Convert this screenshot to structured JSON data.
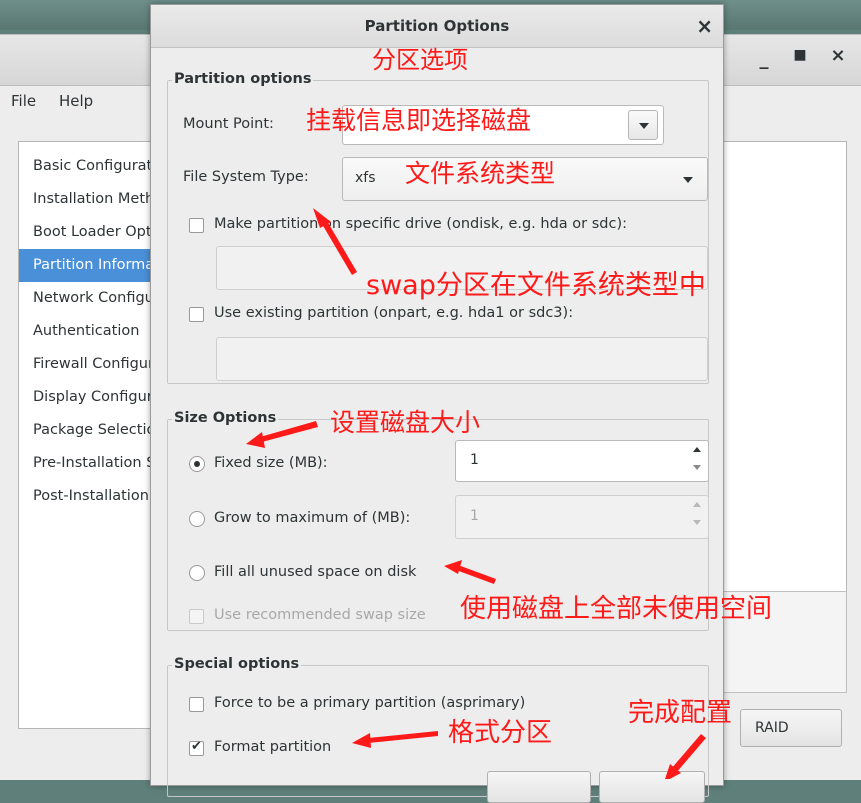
{
  "main_window": {
    "menu": [
      "File",
      "Help"
    ],
    "sidebar_items": [
      "Basic Configuration",
      "Installation Method",
      "Boot Loader Options",
      "Partition Information",
      "Network Configuration",
      "Authentication",
      "Firewall Configuration",
      "Display Configuration",
      "Package Selection",
      "Pre-Installation Script",
      "Post-Installation Script"
    ],
    "selected_index": 3,
    "raid_button": "RAID"
  },
  "dialog": {
    "title": "Partition Options",
    "close_glyph": "×",
    "partition_options": {
      "heading": "Partition options",
      "mount_point_label": "Mount Point:",
      "mount_point_value": "",
      "fs_type_label": "File System Type:",
      "fs_type_value": "xfs",
      "ondisk_label": "Make partition on specific drive (ondisk, e.g. hda or sdc):",
      "ondisk_checked": false,
      "ondisk_value": "",
      "onpart_label": "Use existing partition (onpart, e.g. hda1 or sdc3):",
      "onpart_checked": false,
      "onpart_value": ""
    },
    "size_options": {
      "heading": "Size Options",
      "fixed_label": "Fixed size (MB):",
      "fixed_value": "1",
      "fixed_selected": true,
      "grow_label": "Grow to maximum of (MB):",
      "grow_value": "1",
      "fill_label": "Fill all unused space on disk",
      "swap_label": "Use recommended swap size",
      "swap_checked": false
    },
    "special_options": {
      "heading": "Special options",
      "primary_label": "Force to be a primary partition (asprimary)",
      "primary_checked": false,
      "format_label": "Format partition",
      "format_checked": true
    }
  },
  "annotations": {
    "color": "#ff1a1a",
    "title_note": "分区选项",
    "mount_note": "挂载信息即选择磁盘",
    "fs_note": "文件系统类型",
    "swap_note": "swap分区在文件系统类型中",
    "size_note": "设置磁盘大小",
    "fill_note": "使用磁盘上全部未使用空间",
    "format_note": "格式分区",
    "done_note": "完成配置"
  }
}
